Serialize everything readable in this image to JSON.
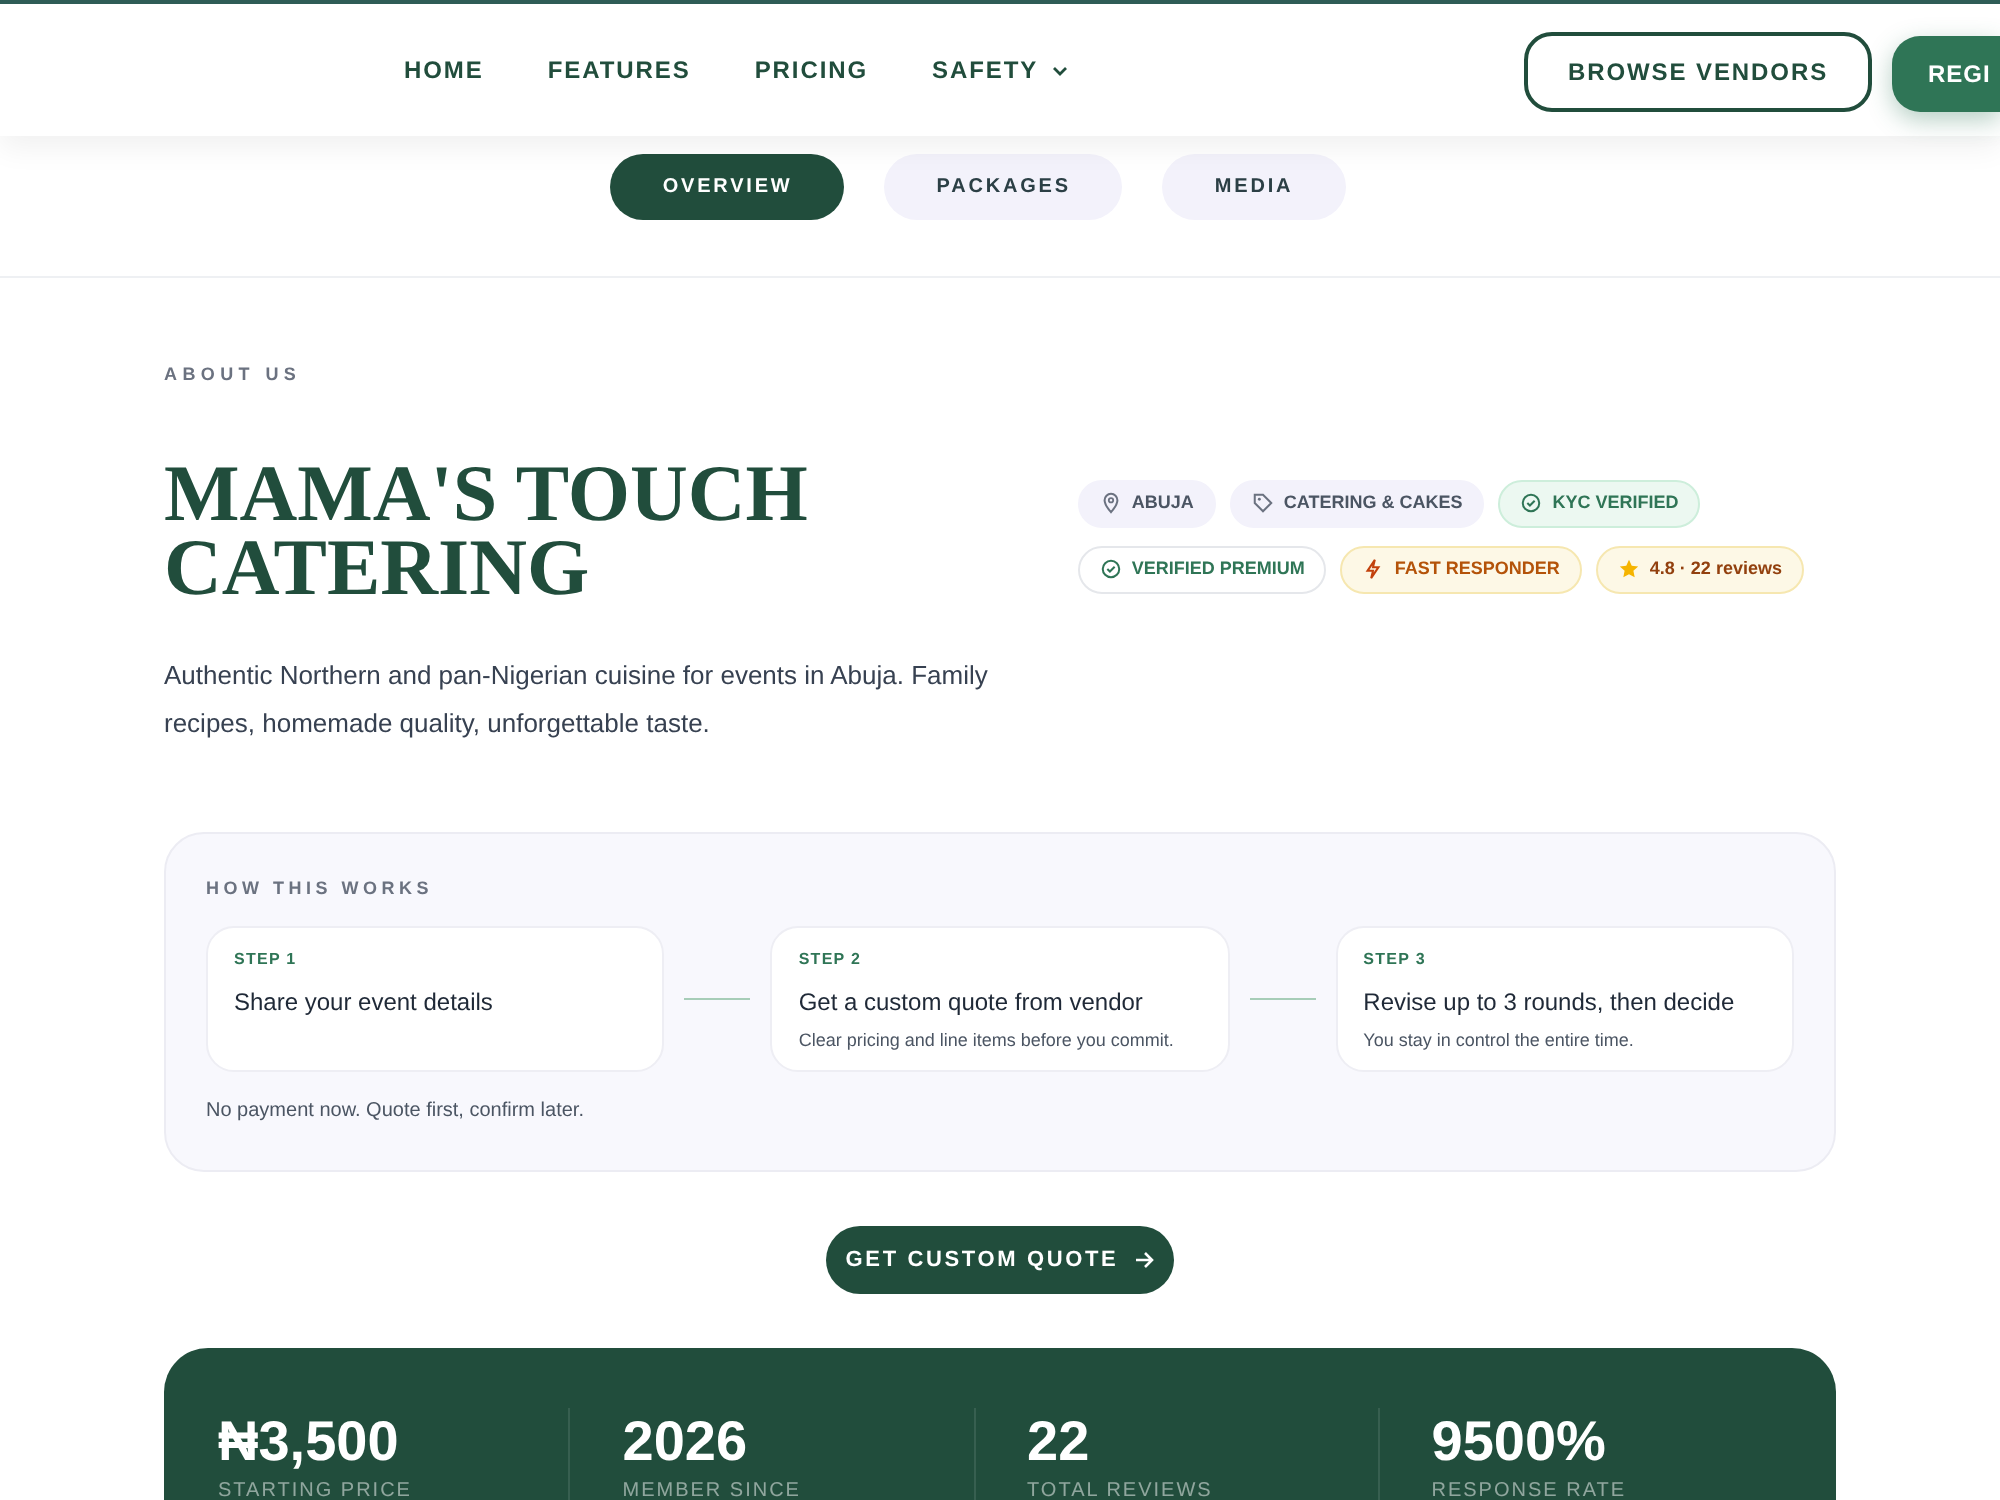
{
  "nav": {
    "items": [
      {
        "label": "HOME",
        "dropdown": false
      },
      {
        "label": "FEATURES",
        "dropdown": false
      },
      {
        "label": "PRICING",
        "dropdown": false
      },
      {
        "label": "SAFETY",
        "dropdown": true
      }
    ],
    "browse_button": "BROWSE VENDORS",
    "register_button": "REGI"
  },
  "tabs": [
    {
      "label": "OVERVIEW",
      "selected": true
    },
    {
      "label": "PACKAGES",
      "selected": false
    },
    {
      "label": "MEDIA",
      "selected": false
    }
  ],
  "about": {
    "eyebrow": "ABOUT US",
    "title": "MAMA'S TOUCH CATERING",
    "description": "Authentic Northern and pan-Nigerian cuisine for events in Abuja. Family recipes, homemade quality, unforgettable taste.",
    "badges": [
      {
        "kind": "location",
        "label": "ABUJA"
      },
      {
        "kind": "category",
        "label": "CATERING & CAKES"
      },
      {
        "kind": "kyc",
        "label": "KYC VERIFIED"
      },
      {
        "kind": "premium",
        "label": "VERIFIED PREMIUM"
      },
      {
        "kind": "fast",
        "label": "FAST RESPONDER"
      },
      {
        "kind": "rating",
        "label": "4.8 · 22 reviews"
      }
    ]
  },
  "how_it_works": {
    "heading": "HOW THIS WORKS",
    "steps": [
      {
        "step": "STEP 1",
        "title": "Share your event details"
      },
      {
        "step": "STEP 2",
        "title": "Get a custom quote from vendor",
        "note": "Clear pricing and line items before you commit."
      },
      {
        "step": "STEP 3",
        "title": "Revise up to 3 rounds, then decide",
        "note": "You stay in control the entire time."
      }
    ],
    "footnote": "No payment now. Quote first, confirm later."
  },
  "cta_button": "GET CUSTOM QUOTE",
  "stats": [
    {
      "value": "₦3,500",
      "label": "STARTING PRICE"
    },
    {
      "value": "2026",
      "label": "MEMBER SINCE"
    },
    {
      "value": "22",
      "label": "TOTAL REVIEWS"
    },
    {
      "value": "9500%",
      "label": "RESPONSE RATE"
    }
  ]
}
